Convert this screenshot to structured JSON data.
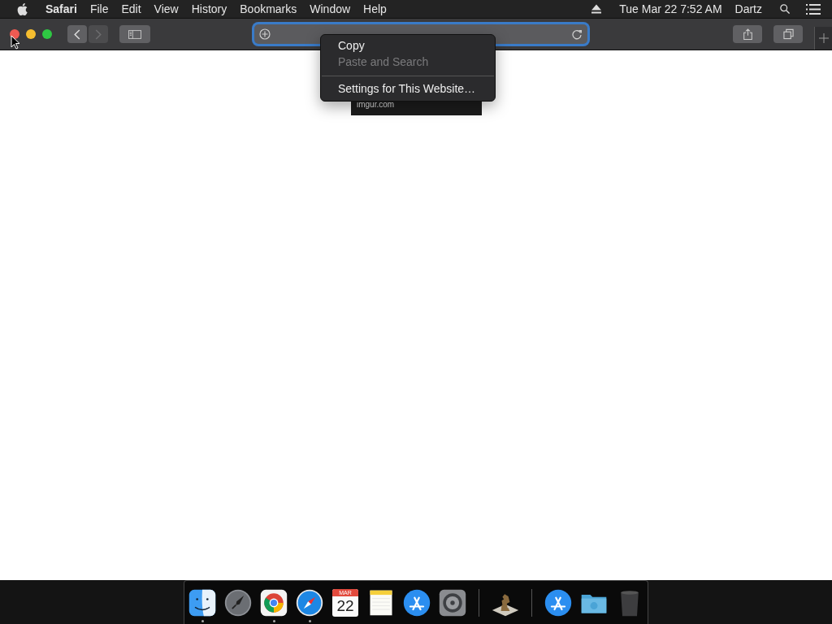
{
  "menu_bar": {
    "app_name": "Safari",
    "menus": [
      "File",
      "Edit",
      "View",
      "History",
      "Bookmarks",
      "Window",
      "Help"
    ],
    "clock": "Tue Mar 22  7:52 AM",
    "user": "Dartz"
  },
  "toolbar": {
    "back_disabled": false,
    "forward_disabled": true
  },
  "context_menu": {
    "items": [
      {
        "kind": "item",
        "label": "Copy",
        "disabled": false
      },
      {
        "kind": "item",
        "label": "Paste and Search",
        "disabled": true
      },
      {
        "kind": "separator"
      },
      {
        "kind": "item",
        "label": "Settings for This Website…",
        "disabled": false
      }
    ]
  },
  "tooltip": "imgur.com",
  "dock": {
    "items": [
      {
        "kind": "finder",
        "running": true
      },
      {
        "kind": "launchpad",
        "running": false
      },
      {
        "kind": "chrome",
        "running": true
      },
      {
        "kind": "safari",
        "running": true
      },
      {
        "kind": "calendar",
        "running": false,
        "month": "MAR",
        "day": "22"
      },
      {
        "kind": "notes",
        "running": false
      },
      {
        "kind": "appstore",
        "running": false
      },
      {
        "kind": "settings",
        "running": false
      },
      {
        "kind": "divider"
      },
      {
        "kind": "chess",
        "running": false
      },
      {
        "kind": "divider"
      },
      {
        "kind": "appstore",
        "running": false
      },
      {
        "kind": "folder",
        "running": false
      },
      {
        "kind": "trash",
        "running": false
      }
    ]
  }
}
